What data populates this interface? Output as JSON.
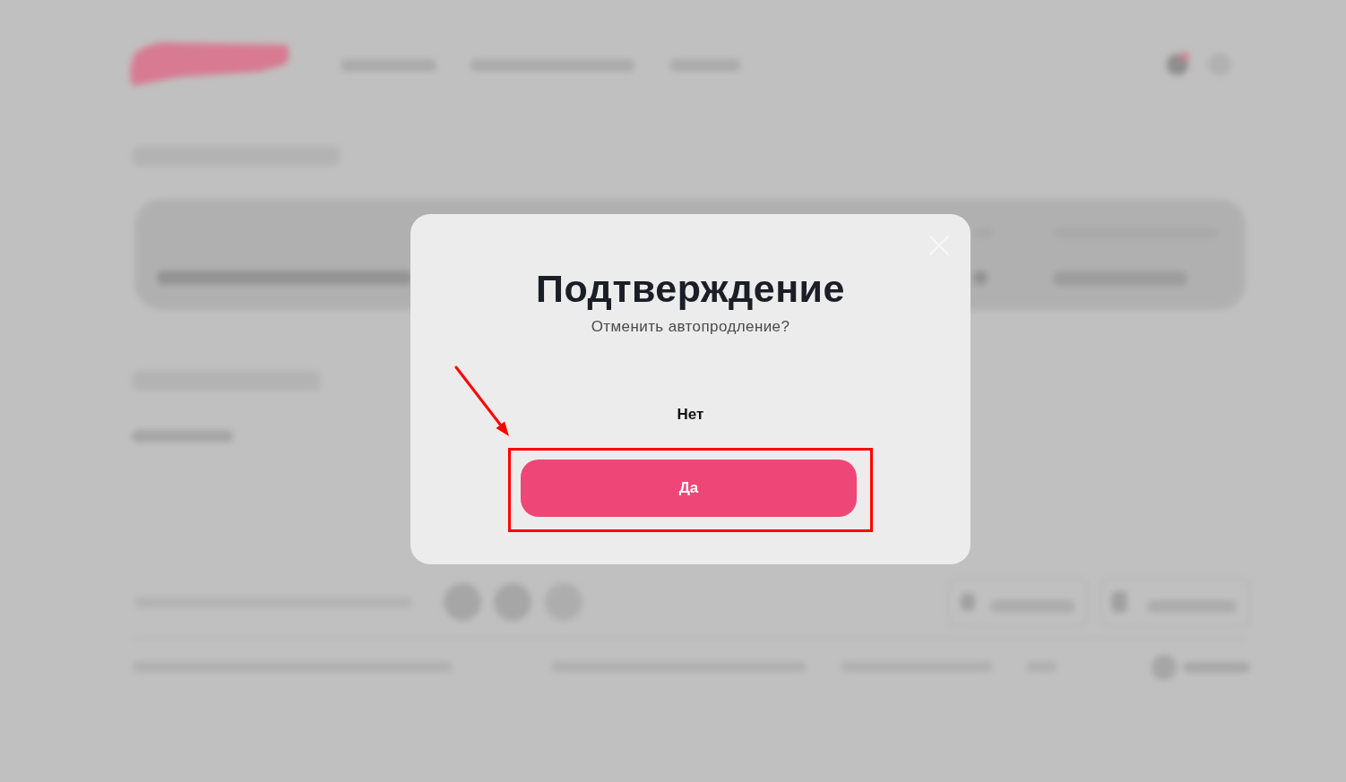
{
  "page_behind": {
    "blurred": true
  },
  "dialog": {
    "title": "Подтверждение",
    "message": "Отменить автопродление?",
    "buttons": [
      {
        "label": "Нет",
        "kind": "text",
        "highlighted": false
      },
      {
        "label": "Да",
        "kind": "primary",
        "highlighted": true
      }
    ]
  }
}
